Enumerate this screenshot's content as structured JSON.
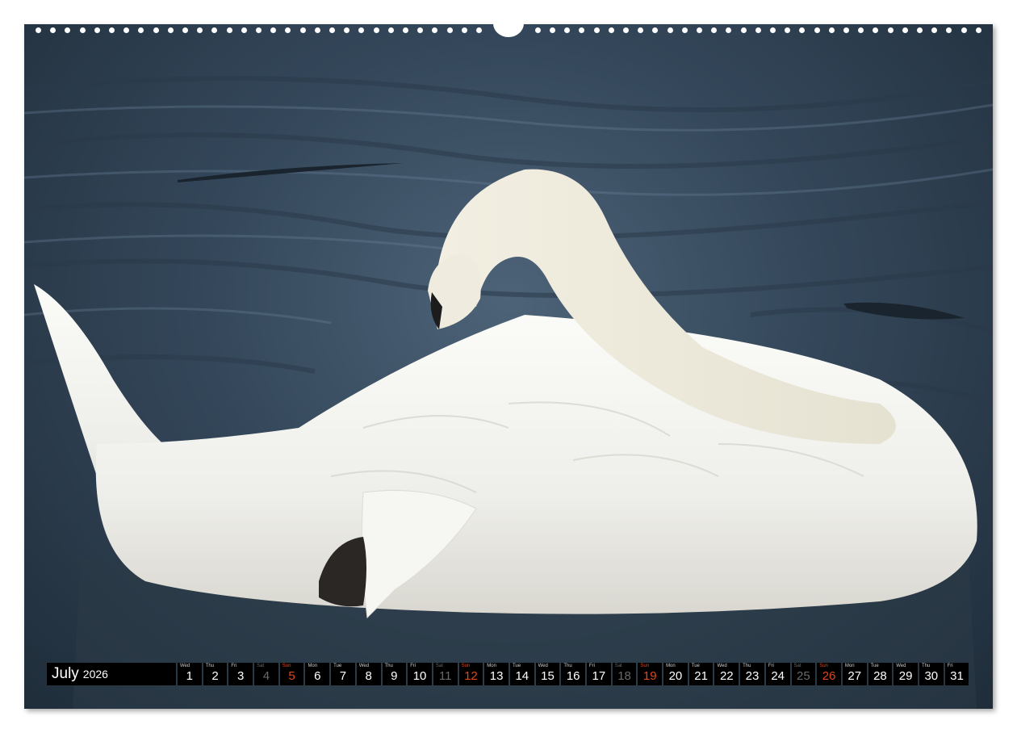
{
  "calendar": {
    "month": "July",
    "year": "2026",
    "days": [
      {
        "dow": "Wed",
        "num": "1",
        "type": "weekday"
      },
      {
        "dow": "Thu",
        "num": "2",
        "type": "weekday"
      },
      {
        "dow": "Fri",
        "num": "3",
        "type": "weekday"
      },
      {
        "dow": "Sat",
        "num": "4",
        "type": "sat"
      },
      {
        "dow": "Sun",
        "num": "5",
        "type": "sun"
      },
      {
        "dow": "Mon",
        "num": "6",
        "type": "weekday"
      },
      {
        "dow": "Tue",
        "num": "7",
        "type": "weekday"
      },
      {
        "dow": "Wed",
        "num": "8",
        "type": "weekday"
      },
      {
        "dow": "Thu",
        "num": "9",
        "type": "weekday"
      },
      {
        "dow": "Fri",
        "num": "10",
        "type": "weekday"
      },
      {
        "dow": "Sat",
        "num": "11",
        "type": "sat"
      },
      {
        "dow": "Sun",
        "num": "12",
        "type": "sun"
      },
      {
        "dow": "Mon",
        "num": "13",
        "type": "weekday"
      },
      {
        "dow": "Tue",
        "num": "14",
        "type": "weekday"
      },
      {
        "dow": "Wed",
        "num": "15",
        "type": "weekday"
      },
      {
        "dow": "Thu",
        "num": "16",
        "type": "weekday"
      },
      {
        "dow": "Fri",
        "num": "17",
        "type": "weekday"
      },
      {
        "dow": "Sat",
        "num": "18",
        "type": "sat"
      },
      {
        "dow": "Sun",
        "num": "19",
        "type": "sun"
      },
      {
        "dow": "Mon",
        "num": "20",
        "type": "weekday"
      },
      {
        "dow": "Tue",
        "num": "21",
        "type": "weekday"
      },
      {
        "dow": "Wed",
        "num": "22",
        "type": "weekday"
      },
      {
        "dow": "Thu",
        "num": "23",
        "type": "weekday"
      },
      {
        "dow": "Fri",
        "num": "24",
        "type": "weekday"
      },
      {
        "dow": "Sat",
        "num": "25",
        "type": "sat"
      },
      {
        "dow": "Sun",
        "num": "26",
        "type": "sun"
      },
      {
        "dow": "Mon",
        "num": "27",
        "type": "weekday"
      },
      {
        "dow": "Tue",
        "num": "28",
        "type": "weekday"
      },
      {
        "dow": "Wed",
        "num": "29",
        "type": "weekday"
      },
      {
        "dow": "Thu",
        "num": "30",
        "type": "weekday"
      },
      {
        "dow": "Fri",
        "num": "31",
        "type": "weekday"
      }
    ]
  },
  "colors": {
    "water": "#34475a",
    "swan": "#f4f3ef",
    "strip": "#000000",
    "sunday": "#e2461c",
    "saturday": "#6a6a6a"
  }
}
